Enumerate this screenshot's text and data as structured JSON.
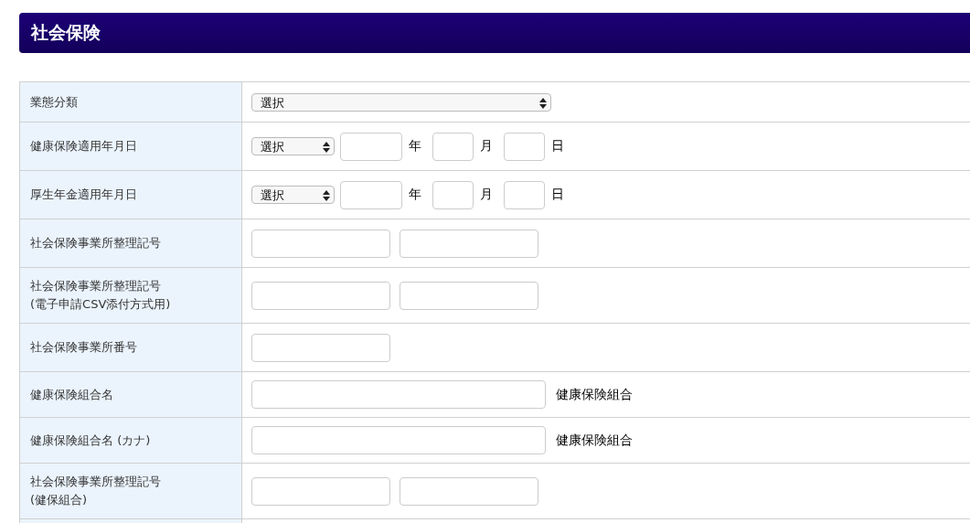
{
  "section": {
    "title": "社会保険"
  },
  "form": {
    "rows": [
      {
        "label": "業態分類",
        "controls": [
          {
            "kind": "select_long",
            "value": "選択"
          }
        ]
      },
      {
        "label": "健康保険適用年月日",
        "controls": [
          {
            "kind": "select",
            "value": "選択"
          },
          {
            "kind": "year_input"
          },
          {
            "kind": "unit",
            "text": "年"
          },
          {
            "kind": "day_input"
          },
          {
            "kind": "unit",
            "text": "月"
          },
          {
            "kind": "day_input"
          },
          {
            "kind": "unit",
            "text": "日"
          }
        ]
      },
      {
        "label": "厚生年金適用年月日",
        "controls": [
          {
            "kind": "select",
            "value": "選択"
          },
          {
            "kind": "year_input"
          },
          {
            "kind": "unit",
            "text": "年"
          },
          {
            "kind": "day_input"
          },
          {
            "kind": "unit",
            "text": "月"
          },
          {
            "kind": "day_input"
          },
          {
            "kind": "unit",
            "text": "日"
          }
        ]
      },
      {
        "label": "社会保険事業所整理記号",
        "controls": [
          {
            "kind": "text_input"
          },
          {
            "kind": "text_input"
          }
        ]
      },
      {
        "label": "社会保険事業所整理記号\n(電子申請CSV添付方式用)",
        "controls": [
          {
            "kind": "text_input"
          },
          {
            "kind": "text_input"
          }
        ]
      },
      {
        "label": "社会保険事業所番号",
        "controls": [
          {
            "kind": "text_input"
          }
        ]
      },
      {
        "label": "健康保険組合名",
        "controls": [
          {
            "kind": "long_input"
          },
          {
            "kind": "unit",
            "text": "健康保険組合"
          }
        ]
      },
      {
        "label": "健康保険組合名 (カナ)",
        "controls": [
          {
            "kind": "long_input"
          },
          {
            "kind": "unit",
            "text": "健康保険組合"
          }
        ]
      },
      {
        "label": "社会保険事業所整理記号\n(健保組合)",
        "controls": [
          {
            "kind": "text_input"
          },
          {
            "kind": "text_input"
          }
        ]
      }
    ]
  }
}
